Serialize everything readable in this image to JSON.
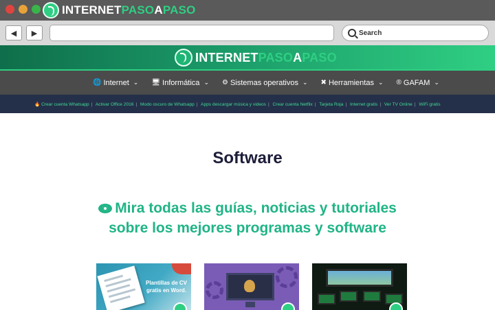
{
  "brand": {
    "part1": "INTERNET",
    "part2": "PASO",
    "part3": "A",
    "part4": "PASO",
    "accent": "#2fcf83"
  },
  "browser": {
    "back_icon": "◀",
    "forward_icon": "▶",
    "url_value": "",
    "search_placeholder": "Search"
  },
  "menu": {
    "items": [
      {
        "icon": "globe-icon",
        "glyph": "🌐",
        "label": "Internet"
      },
      {
        "icon": "monitor-icon",
        "glyph": "🖥",
        "label": "Informática"
      },
      {
        "icon": "gear-icon",
        "glyph": "⚙",
        "label": "Sistemas operativos"
      },
      {
        "icon": "tools-icon",
        "glyph": "✖",
        "label": "Herramientas"
      },
      {
        "icon": "gafam-icon",
        "glyph": "®",
        "label": "GAFAM"
      }
    ],
    "chevron": "⌄"
  },
  "quick_links": {
    "fire_glyph": "🔥",
    "items": [
      "Crear cuenta Whatsapp",
      "Activar Office 2016",
      "Modo oscuro de Whatsapp",
      "Apps descargar música y videos",
      "Crear cuenta Netflix",
      "Tarjeta Roja",
      "Internet gratis",
      "Ver TV Online",
      "WiFi gratis"
    ],
    "separator": "|"
  },
  "content": {
    "title": "Software",
    "lead_line1": "Mira todas las guías, noticias y tutoriales",
    "lead_line2": "sobre los mejores programas y software"
  },
  "cards": [
    {
      "caption": "Plantillas de CV gratis en Word."
    },
    {
      "caption": ""
    },
    {
      "caption": ""
    }
  ]
}
